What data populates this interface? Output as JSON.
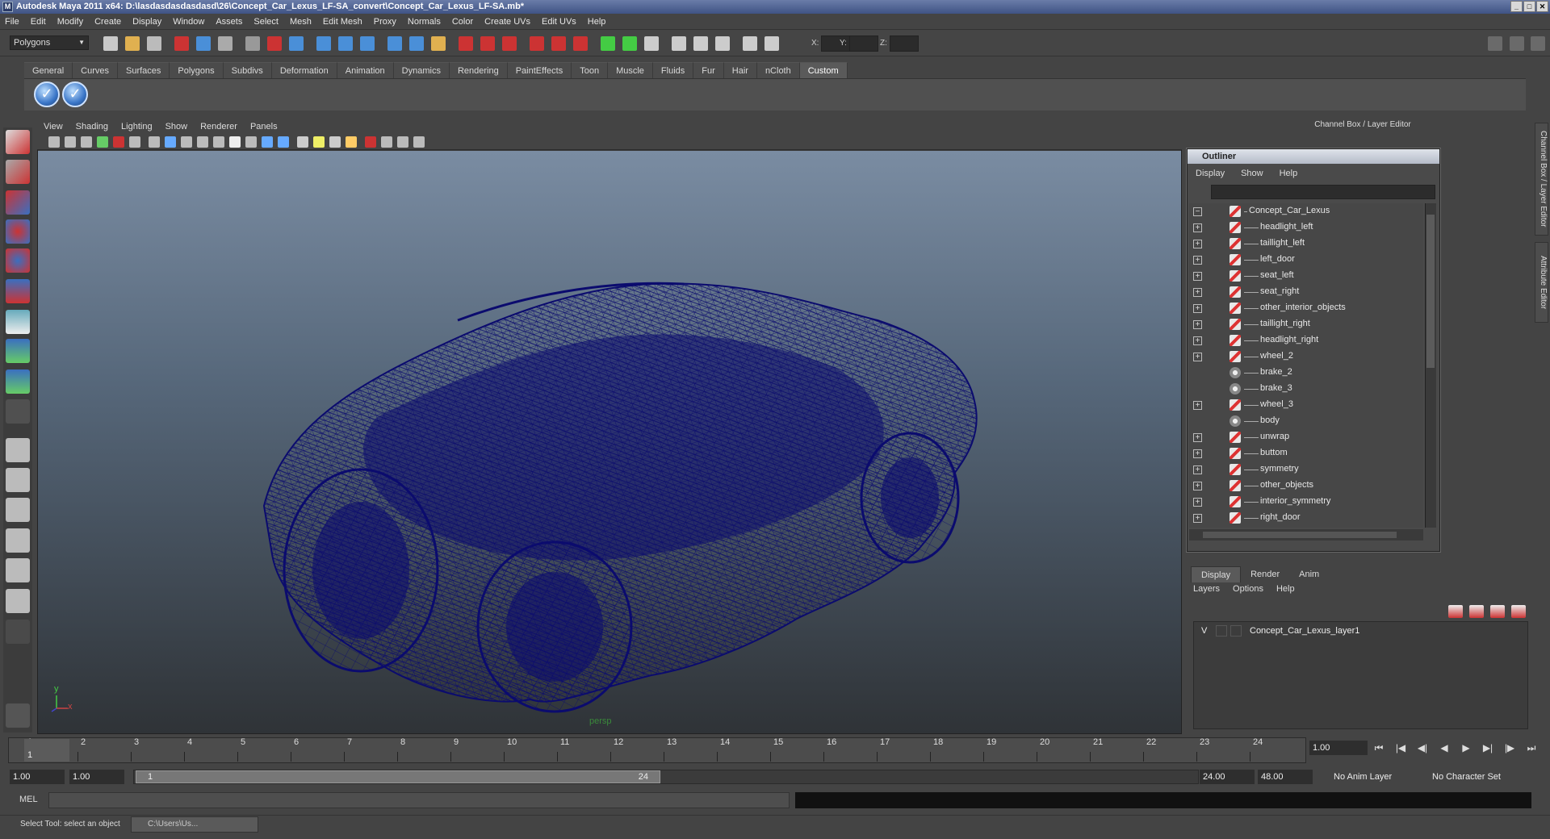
{
  "window": {
    "title": "Autodesk Maya 2011 x64: D:\\lasdasdasdasdasd\\26\\Concept_Car_Lexus_LF-SA_convert\\Concept_Car_Lexus_LF-SA.mb*",
    "logo": "M",
    "min_icon": "_",
    "max_icon": "□",
    "close_icon": "✕"
  },
  "menubar": [
    "File",
    "Edit",
    "Modify",
    "Create",
    "Display",
    "Window",
    "Assets",
    "Select",
    "Mesh",
    "Edit Mesh",
    "Proxy",
    "Normals",
    "Color",
    "Create UVs",
    "Edit UVs",
    "Help"
  ],
  "statusline": {
    "mode": "Polygons",
    "x_label": "X:",
    "y_label": "Y:",
    "z_label": "Z:"
  },
  "shelf": {
    "tabs": [
      "General",
      "Curves",
      "Surfaces",
      "Polygons",
      "Subdivs",
      "Deformation",
      "Animation",
      "Dynamics",
      "Rendering",
      "PaintEffects",
      "Toon",
      "Muscle",
      "Fluids",
      "Fur",
      "Hair",
      "nCloth",
      "Custom"
    ],
    "active": "Custom",
    "buttons": [
      "check-icon",
      "check-icon"
    ],
    "check": "✓"
  },
  "viewport": {
    "menu": [
      "View",
      "Shading",
      "Lighting",
      "Show",
      "Renderer",
      "Panels"
    ],
    "camera_label": "persp",
    "axis_x": "x",
    "axis_y": "y",
    "wire_color": "#0b0b6e"
  },
  "right_panel": {
    "header": "Channel Box / Layer Editor",
    "side_tabs": [
      "Channel Box / Layer Editor",
      "Attribute Editor"
    ]
  },
  "outliner": {
    "title": "Outliner",
    "menu": [
      "Display",
      "Show",
      "Help"
    ],
    "items": [
      {
        "label": "Concept_Car_Lexus",
        "expand": "−",
        "icon": "mesh"
      },
      {
        "label": "headlight_left",
        "expand": "+",
        "icon": "mesh"
      },
      {
        "label": "taillight_left",
        "expand": "+",
        "icon": "mesh"
      },
      {
        "label": "left_door",
        "expand": "+",
        "icon": "mesh"
      },
      {
        "label": "seat_left",
        "expand": "+",
        "icon": "mesh"
      },
      {
        "label": "seat_right",
        "expand": "+",
        "icon": "mesh"
      },
      {
        "label": "other_interior_objects",
        "expand": "+",
        "icon": "mesh"
      },
      {
        "label": "taillight_right",
        "expand": "+",
        "icon": "mesh"
      },
      {
        "label": "headlight_right",
        "expand": "+",
        "icon": "mesh"
      },
      {
        "label": "wheel_2",
        "expand": "+",
        "icon": "mesh"
      },
      {
        "label": "brake_2",
        "expand": "",
        "icon": "grp"
      },
      {
        "label": "brake_3",
        "expand": "",
        "icon": "grp"
      },
      {
        "label": "wheel_3",
        "expand": "+",
        "icon": "mesh"
      },
      {
        "label": "body",
        "expand": "",
        "icon": "grp"
      },
      {
        "label": "unwrap",
        "expand": "+",
        "icon": "mesh"
      },
      {
        "label": "buttom",
        "expand": "+",
        "icon": "mesh"
      },
      {
        "label": "symmetry",
        "expand": "+",
        "icon": "mesh"
      },
      {
        "label": "other_objects",
        "expand": "+",
        "icon": "mesh"
      },
      {
        "label": "interior_symmetry",
        "expand": "+",
        "icon": "mesh"
      },
      {
        "label": "right_door",
        "expand": "+",
        "icon": "mesh"
      }
    ]
  },
  "layers": {
    "tabs": [
      "Display",
      "Render",
      "Anim"
    ],
    "active": "Display",
    "menu": [
      "Layers",
      "Options",
      "Help"
    ],
    "row": {
      "visible": "V",
      "name": "Concept_Car_Lexus_layer1"
    }
  },
  "timeline": {
    "ticks": [
      "1",
      "2",
      "3",
      "4",
      "5",
      "6",
      "7",
      "8",
      "9",
      "10",
      "11",
      "12",
      "13",
      "14",
      "15",
      "16",
      "17",
      "18",
      "19",
      "20",
      "21",
      "22",
      "23",
      "24"
    ],
    "current_frame": "1.00",
    "frame_marker": "1"
  },
  "range": {
    "start": "1.00",
    "start2": "1.00",
    "slider_start": "1",
    "slider_end": "24",
    "end": "24.00",
    "end2": "48.00",
    "anim_layer": "No Anim Layer",
    "char_set": "No Character Set"
  },
  "mel": {
    "label": "MEL"
  },
  "help_line": {
    "text": "Select Tool: select an object",
    "task": "C:\\Users\\Us..."
  },
  "playback": [
    "⏮",
    "|◀",
    "◀|",
    "◀",
    "▶",
    "▶|",
    "|▶",
    "⏭"
  ]
}
